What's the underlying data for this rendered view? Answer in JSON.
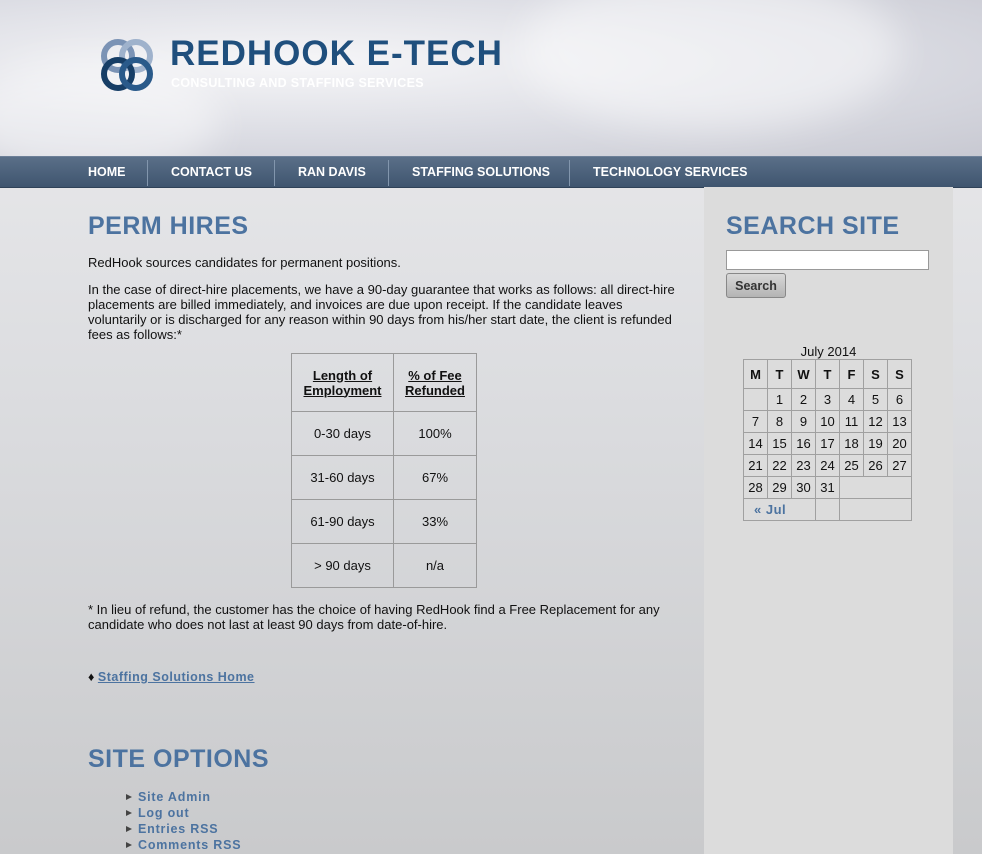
{
  "header": {
    "brand_name": "REDHOOK E-TECH",
    "tagline": "CONSULTING AND STAFFING SERVICES"
  },
  "nav": {
    "items": [
      {
        "label": "HOME"
      },
      {
        "label": "CONTACT US"
      },
      {
        "label": "RAN DAVIS"
      },
      {
        "label": "STAFFING SOLUTIONS"
      },
      {
        "label": "TECHNOLOGY SERVICES"
      }
    ]
  },
  "main": {
    "title": "PERM HIRES",
    "intro": "RedHook sources candidates for permanent positions.",
    "guarantee": "In the case of direct-hire placements, we have a 90-day guarantee that works as follows: all direct-hire placements are billed immediately, and invoices are due upon receipt. If the candidate leaves voluntarily or is discharged for any reason within 90 days from his/her start date, the client is refunded fees as follows:*",
    "table": {
      "headers": [
        "Length of Employment",
        "% of Fee Refunded"
      ],
      "rows": [
        [
          "0-30 days",
          "100%"
        ],
        [
          "31-60 days",
          "67%"
        ],
        [
          "61-90 days",
          "33%"
        ],
        [
          "> 90 days",
          "n/a"
        ]
      ]
    },
    "footnote": "* In lieu of refund, the customer has the choice of having RedHook find a Free Replacement for any candidate who does not last at least 90 days from date-of-hire.",
    "link_bullet": "♦",
    "staffing_link": "Staffing Solutions Home"
  },
  "site_options": {
    "title": "SITE OPTIONS",
    "items": [
      {
        "label": "Site Admin"
      },
      {
        "label": "Log out"
      },
      {
        "label": "Entries RSS"
      },
      {
        "label": "Comments RSS"
      }
    ]
  },
  "sidebar": {
    "search_title": "SEARCH SITE",
    "search_value": "",
    "search_button": "Search",
    "calendar": {
      "caption": "July 2014",
      "weekdays": [
        "M",
        "T",
        "W",
        "T",
        "F",
        "S",
        "S"
      ],
      "weeks": [
        [
          "",
          "1",
          "2",
          "3",
          "4",
          "5",
          "6"
        ],
        [
          "7",
          "8",
          "9",
          "10",
          "11",
          "12",
          "13"
        ],
        [
          "14",
          "15",
          "16",
          "17",
          "18",
          "19",
          "20"
        ],
        [
          "21",
          "22",
          "23",
          "24",
          "25",
          "26",
          "27"
        ],
        [
          "28",
          "29",
          "30",
          "31",
          "",
          "",
          ""
        ]
      ],
      "prev_link": "« Jul"
    }
  },
  "colors": {
    "accent": "#4c73a0",
    "nav_bg": "#4a5f79",
    "brand": "#1f4f7d"
  }
}
